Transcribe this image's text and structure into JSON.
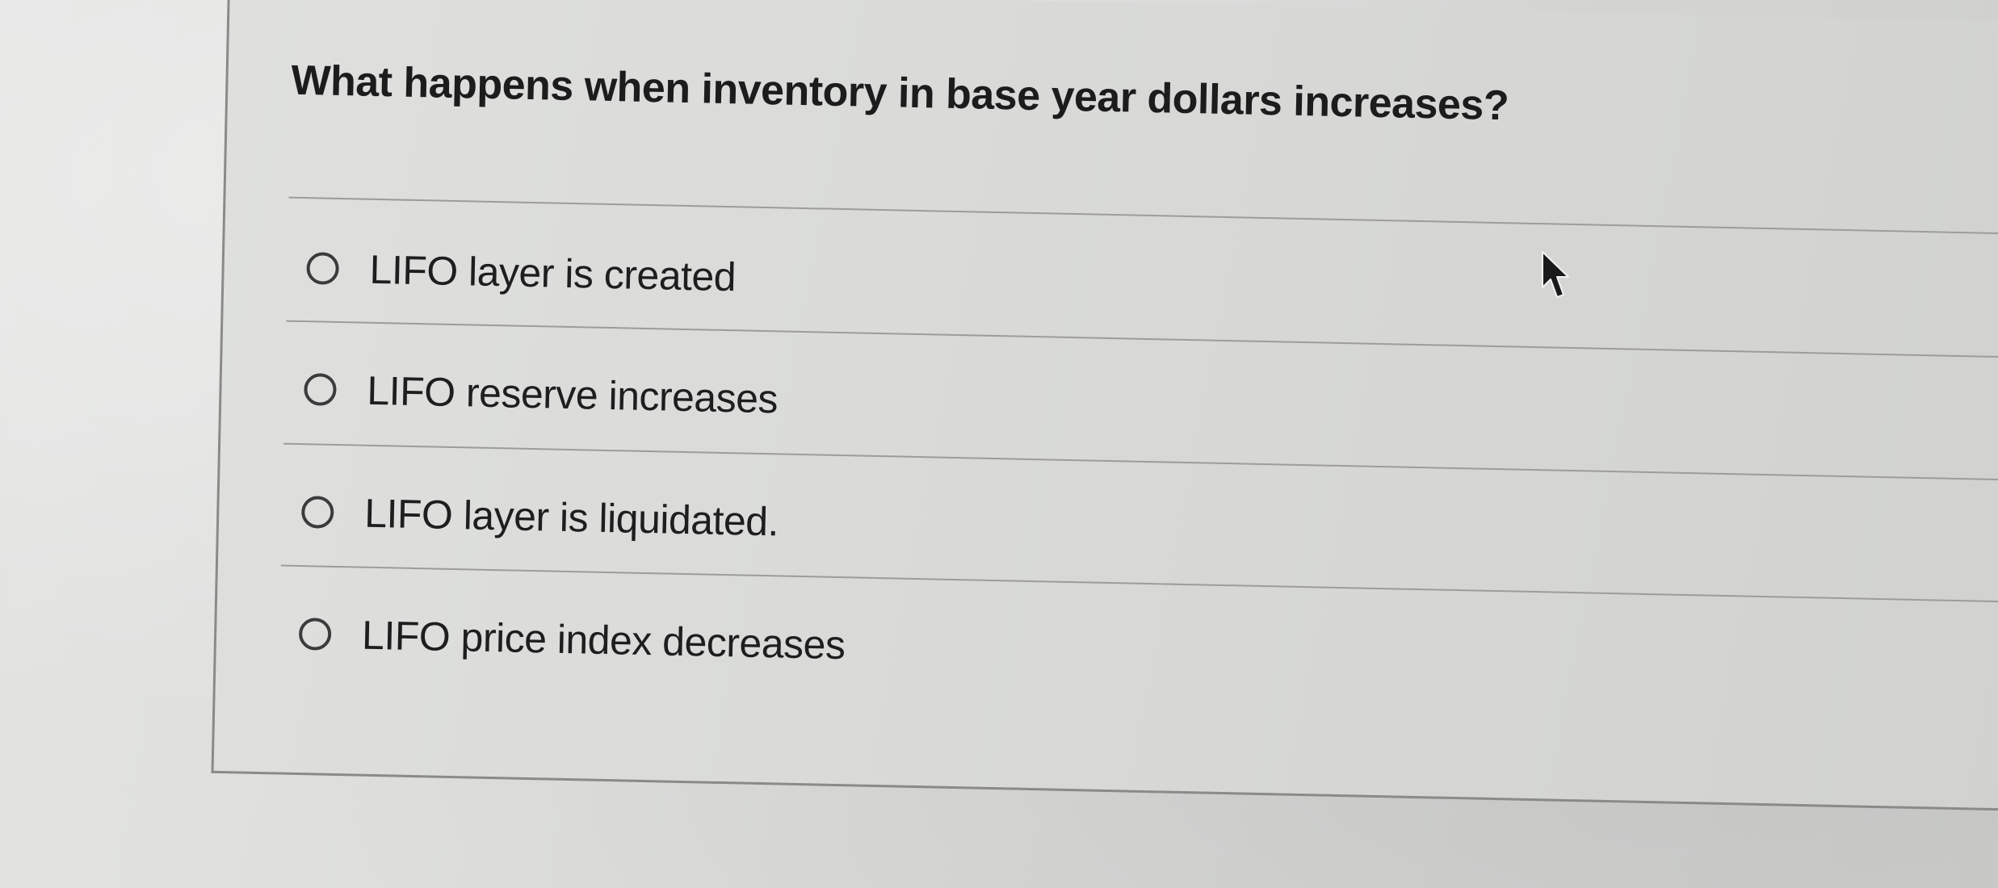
{
  "question": {
    "text": "What happens when inventory in base year dollars increases?"
  },
  "options": [
    {
      "label": "LIFO layer is created",
      "selected": false
    },
    {
      "label": "LIFO reserve increases",
      "selected": false
    },
    {
      "label": "LIFO layer is liquidated.",
      "selected": false
    },
    {
      "label": "LIFO price index decreases",
      "selected": false
    }
  ],
  "colors": {
    "text": "#1c1c1c",
    "divider": "#9c9d9b",
    "radio_border": "#3a3b3a"
  },
  "icons": {
    "pointer": "mouse-pointer-icon",
    "radio": "radio-button-icon"
  }
}
